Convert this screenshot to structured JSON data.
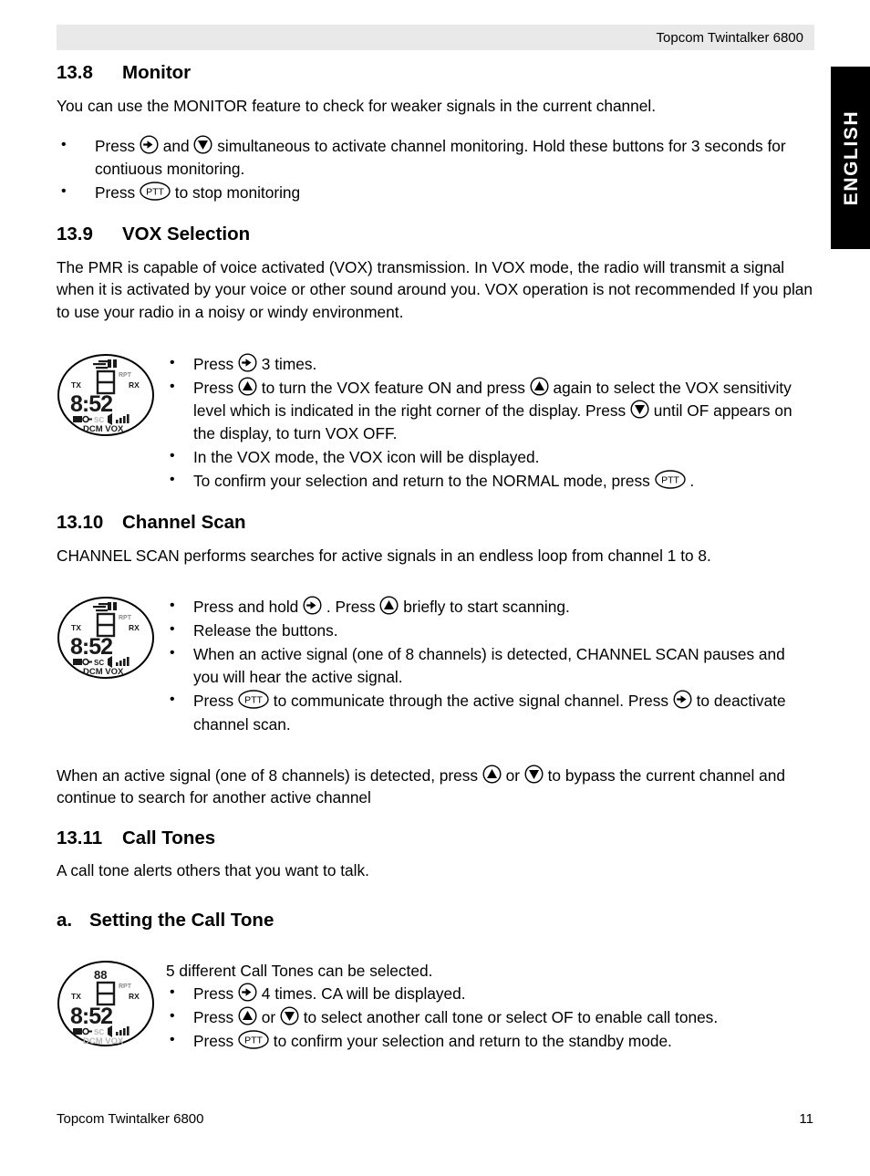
{
  "header": {
    "title": "Topcom Twintalker 6800"
  },
  "side_tab": {
    "label": "ENGLISH"
  },
  "sections": {
    "monitor": {
      "number": "13.8",
      "title": "Monitor",
      "intro": "You can use the MONITOR feature to check for weaker signals in the current channel.",
      "bullets": [
        {
          "parts": [
            {
              "type": "text",
              "value": "Press "
            },
            {
              "type": "icon",
              "value": "menu-button-icon"
            },
            {
              "type": "text",
              "value": " and "
            },
            {
              "type": "icon",
              "value": "down-button-icon"
            },
            {
              "type": "text",
              "value": " simultaneous to activate channel monitoring. Hold these buttons for 3 seconds for contiuous monitoring."
            }
          ]
        },
        {
          "parts": [
            {
              "type": "text",
              "value": "Press "
            },
            {
              "type": "icon",
              "value": "ptt-button-icon"
            },
            {
              "type": "text",
              "value": " to stop monitoring"
            }
          ]
        }
      ]
    },
    "vox": {
      "number": "13.9",
      "title": "VOX Selection",
      "intro": "The PMR is capable of voice activated (VOX) transmission. In VOX mode, the radio will transmit a signal when it is activated by your voice or other sound around you. VOX operation is not recommended If you plan to use your radio in a noisy or windy environment.",
      "bullets": [
        {
          "parts": [
            {
              "type": "text",
              "value": "Press "
            },
            {
              "type": "icon",
              "value": "menu-button-icon"
            },
            {
              "type": "text",
              "value": " 3 times."
            }
          ]
        },
        {
          "parts": [
            {
              "type": "text",
              "value": "Press "
            },
            {
              "type": "icon",
              "value": "up-button-icon"
            },
            {
              "type": "text",
              "value": " to turn the VOX feature ON and press "
            },
            {
              "type": "icon",
              "value": "up-button-icon"
            },
            {
              "type": "text",
              "value": " again to select the VOX sensitivity level which is indicated in the right corner of the display. Press "
            },
            {
              "type": "icon",
              "value": "down-button-icon"
            },
            {
              "type": "text",
              "value": " until OF appears on the display, to turn VOX OFF."
            }
          ]
        },
        {
          "parts": [
            {
              "type": "text",
              "value": "In the VOX mode, the VOX icon will be displayed."
            }
          ]
        },
        {
          "parts": [
            {
              "type": "text",
              "value": "To confirm your selection and return to the NORMAL mode, press "
            },
            {
              "type": "icon",
              "value": "ptt-button-icon"
            },
            {
              "type": "text",
              "value": " ."
            }
          ]
        }
      ]
    },
    "channel_scan": {
      "number": "13.10",
      "title": "Channel Scan",
      "intro": "CHANNEL SCAN performs searches for active signals in an endless loop from channel 1 to 8.",
      "bullets": [
        {
          "parts": [
            {
              "type": "text",
              "value": "Press and hold "
            },
            {
              "type": "icon",
              "value": "menu-button-icon"
            },
            {
              "type": "text",
              "value": " . Press "
            },
            {
              "type": "icon",
              "value": "up-button-icon"
            },
            {
              "type": "text",
              "value": " briefly to start scanning."
            }
          ]
        },
        {
          "parts": [
            {
              "type": "text",
              "value": "Release the buttons."
            }
          ]
        },
        {
          "parts": [
            {
              "type": "text",
              "value": "When an active signal (one of 8 channels) is detected, CHANNEL SCAN pauses and you will hear the active signal."
            }
          ]
        },
        {
          "parts": [
            {
              "type": "text",
              "value": "Press "
            },
            {
              "type": "icon",
              "value": "ptt-button-icon"
            },
            {
              "type": "text",
              "value": " to communicate through the active signal channel. Press "
            },
            {
              "type": "icon",
              "value": "menu-button-icon"
            },
            {
              "type": "text",
              "value": " to deactivate channel scan."
            }
          ]
        }
      ],
      "closing": {
        "parts": [
          {
            "type": "text",
            "value": "When an active signal (one of 8 channels) is detected, press "
          },
          {
            "type": "icon",
            "value": "up-button-icon"
          },
          {
            "type": "text",
            "value": " or "
          },
          {
            "type": "icon",
            "value": "down-button-icon"
          },
          {
            "type": "text",
            "value": " to bypass the current channel and continue to search for another active channel"
          }
        ]
      }
    },
    "call_tones": {
      "number": "13.11",
      "title": "Call Tones",
      "intro": "A call tone alerts others that you want to talk.",
      "sub": {
        "letter": "a.",
        "title": "Setting the Call Tone",
        "lead": "5 different Call Tones can be selected.",
        "bullets": [
          {
            "parts": [
              {
                "type": "text",
                "value": "Press "
              },
              {
                "type": "icon",
                "value": "menu-button-icon"
              },
              {
                "type": "text",
                "value": " 4 times. CA will be displayed."
              }
            ]
          },
          {
            "parts": [
              {
                "type": "text",
                "value": "Press "
              },
              {
                "type": "icon",
                "value": "up-button-icon"
              },
              {
                "type": "text",
                "value": " or "
              },
              {
                "type": "icon",
                "value": "down-button-icon"
              },
              {
                "type": "text",
                "value": " to select another call tone or select OF to enable call tones."
              }
            ]
          },
          {
            "parts": [
              {
                "type": "text",
                "value": "Press "
              },
              {
                "type": "icon",
                "value": "ptt-button-icon"
              },
              {
                "type": "text",
                "value": " to confirm your selection and return to the standby mode."
              }
            ]
          }
        ]
      }
    }
  },
  "lcd_displays": {
    "vox": {
      "name": "lcd-display-vox",
      "tx_label": "TX",
      "rx_label": "RX",
      "rpt_label": "RPT",
      "channel_digit": "8",
      "main_digits": "8:52",
      "bottom_indicators": [
        "FM",
        "key",
        "SC",
        "speaker",
        "signal-bars"
      ],
      "mode_labels": "DCM VOX"
    },
    "scan": {
      "name": "lcd-display-scan",
      "tx_label": "TX",
      "rx_label": "RX",
      "rpt_label": "RPT",
      "channel_digit": "8",
      "main_digits": "8:52",
      "bottom_indicators": [
        "FM",
        "key",
        "SC",
        "speaker",
        "signal-bars"
      ],
      "mode_labels": "DCM VOX"
    },
    "calltone": {
      "name": "lcd-display-calltone",
      "tx_label": "TX",
      "rx_label": "RX",
      "rpt_label": "RPT",
      "channel_digit": "8",
      "main_digits": "8:52",
      "bottom_indicators": [
        "FM",
        "key",
        "SC",
        "speaker",
        "signal-bars"
      ],
      "mode_labels": "DCM VOX"
    }
  },
  "ptt_icon_label": "PTT",
  "footer": {
    "left": "Topcom Twintalker 6800",
    "page_number": "11"
  }
}
